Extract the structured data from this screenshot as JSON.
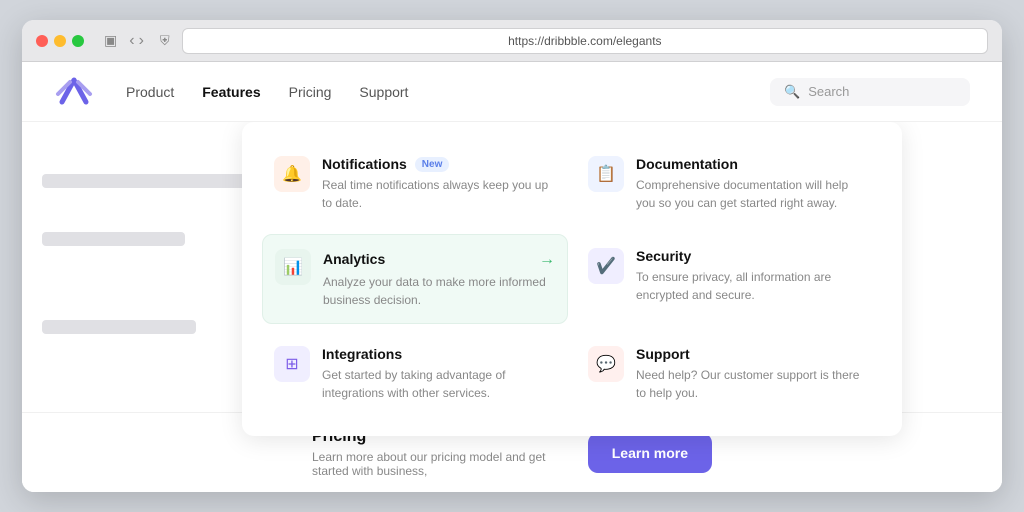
{
  "browser": {
    "address": "https://dribbble.com/elegants"
  },
  "navbar": {
    "logo_alt": "Logo",
    "links": [
      {
        "id": "product",
        "label": "Product",
        "active": false
      },
      {
        "id": "features",
        "label": "Features",
        "active": true
      },
      {
        "id": "pricing",
        "label": "Pricing",
        "active": false
      },
      {
        "id": "support",
        "label": "Support",
        "active": false
      }
    ],
    "search_placeholder": "Search"
  },
  "dropdown": {
    "items": [
      {
        "id": "notifications",
        "title": "Notifications",
        "badge": "New",
        "desc": "Real time notifications always keep you up to date.",
        "icon": "bell",
        "icon_class": "icon-notif",
        "highlighted": false
      },
      {
        "id": "documentation",
        "title": "Documentation",
        "badge": "",
        "desc": "Comprehensive documentation will help you so you can get started right away.",
        "icon": "doc",
        "icon_class": "icon-docs",
        "highlighted": false
      },
      {
        "id": "analytics",
        "title": "Analytics",
        "badge": "",
        "desc": "Analyze your data to make more informed business decision.",
        "icon": "chart",
        "icon_class": "icon-analytics",
        "highlighted": true
      },
      {
        "id": "security",
        "title": "Security",
        "badge": "",
        "desc": "To ensure privacy, all information are encrypted and secure.",
        "icon": "shield",
        "icon_class": "icon-security",
        "highlighted": false
      },
      {
        "id": "integrations",
        "title": "Integrations",
        "badge": "",
        "desc": "Get started by taking advantage of integrations with other services.",
        "icon": "grid",
        "icon_class": "icon-integrations",
        "highlighted": false
      },
      {
        "id": "support",
        "title": "Support",
        "badge": "",
        "desc": "Need help? Our customer support is there to help you.",
        "icon": "chat",
        "icon_class": "icon-support",
        "highlighted": false
      }
    ]
  },
  "pricing": {
    "title": "Pricing",
    "desc": "Learn more about our pricing model and get started with business,",
    "cta": "Learn more"
  }
}
